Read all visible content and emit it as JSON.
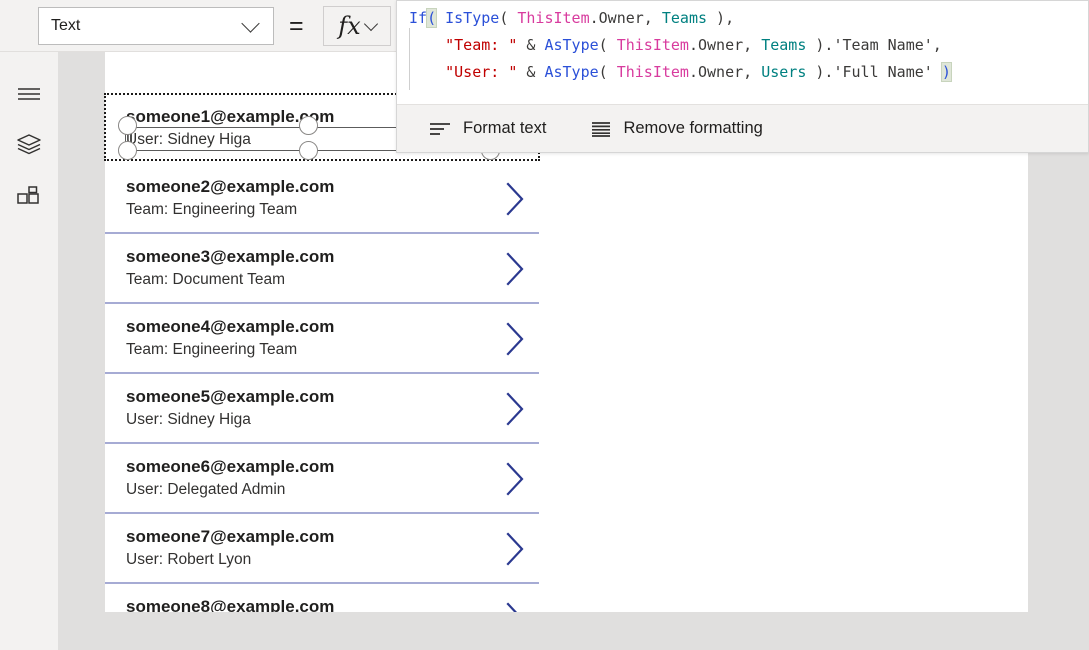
{
  "toolbar": {
    "property_dropdown": {
      "value": "Text",
      "chevron_icon": "chevron-down-icon"
    },
    "equals_sign": "=",
    "fx_button": {
      "glyph": "fx",
      "icon": "function-icon",
      "chevron_icon": "chevron-down-icon"
    }
  },
  "sidebar": {
    "items": [
      {
        "icon": "hamburger-menu-icon",
        "label": "Menu"
      },
      {
        "icon": "layers-tree-view-icon",
        "label": "Tree view"
      },
      {
        "icon": "insert-components-icon",
        "label": "Insert"
      }
    ]
  },
  "formula_bar": {
    "lines": [
      [
        {
          "text": "If",
          "token": "fn"
        },
        {
          "text": "(",
          "token": "bracket-highlight"
        },
        {
          "text": " IsType",
          "token": "fn"
        },
        {
          "text": "( ",
          "token": "punct"
        },
        {
          "text": "ThisItem",
          "token": "item"
        },
        {
          "text": ".Owner, ",
          "token": "plain"
        },
        {
          "text": "Teams",
          "token": "type"
        },
        {
          "text": " ),",
          "token": "punct"
        }
      ],
      [
        {
          "text": "    ",
          "token": "plain"
        },
        {
          "text": "\"Team: \"",
          "token": "str"
        },
        {
          "text": " & ",
          "token": "plain"
        },
        {
          "text": "AsType",
          "token": "fn"
        },
        {
          "text": "( ",
          "token": "punct"
        },
        {
          "text": "ThisItem",
          "token": "item"
        },
        {
          "text": ".Owner, ",
          "token": "plain"
        },
        {
          "text": "Teams",
          "token": "type"
        },
        {
          "text": " ).'Team Name',",
          "token": "plain"
        }
      ],
      [
        {
          "text": "    ",
          "token": "plain"
        },
        {
          "text": "\"User: \"",
          "token": "str"
        },
        {
          "text": " & ",
          "token": "plain"
        },
        {
          "text": "AsType",
          "token": "fn"
        },
        {
          "text": "( ",
          "token": "punct"
        },
        {
          "text": "ThisItem",
          "token": "item"
        },
        {
          "text": ".Owner, ",
          "token": "plain"
        },
        {
          "text": "Users",
          "token": "type"
        },
        {
          "text": " ).'Full Name' ",
          "token": "plain"
        },
        {
          "text": ")",
          "token": "bracket-highlight"
        }
      ]
    ],
    "plain_text": "If( IsType( ThisItem.Owner, Teams ),\n    \"Team: \" & AsType( ThisItem.Owner, Teams ).'Team Name',\n    \"User: \" & AsType( ThisItem.Owner, Users ).'Full Name' )",
    "format_bar": {
      "format_text": {
        "label": "Format text",
        "icon": "format-text-icon"
      },
      "remove_formatting": {
        "label": "Remove formatting",
        "icon": "remove-formatting-icon"
      }
    }
  },
  "gallery": {
    "chevron_icon": "chevron-right-icon",
    "items": [
      {
        "title": "someone1@example.com",
        "subtitle": "User: Sidney Higa",
        "selected": true
      },
      {
        "title": "someone2@example.com",
        "subtitle": "Team: Engineering Team",
        "selected": false
      },
      {
        "title": "someone3@example.com",
        "subtitle": "Team: Document Team",
        "selected": false
      },
      {
        "title": "someone4@example.com",
        "subtitle": "Team: Engineering Team",
        "selected": false
      },
      {
        "title": "someone5@example.com",
        "subtitle": "User: Sidney Higa",
        "selected": false
      },
      {
        "title": "someone6@example.com",
        "subtitle": "User: Delegated Admin",
        "selected": false
      },
      {
        "title": "someone7@example.com",
        "subtitle": "User: Robert Lyon",
        "selected": false
      },
      {
        "title": "someone8@example.com",
        "subtitle": "",
        "selected": false
      }
    ]
  },
  "colors": {
    "separator": "#a6abd4",
    "chevron": "#2b3990",
    "function_token": "#2b50d8",
    "record_token": "#d83b9e",
    "type_token": "#008080",
    "string_token": "#c00000",
    "canvas_background": "#e0dfde",
    "rail_background": "#f3f2f1"
  }
}
